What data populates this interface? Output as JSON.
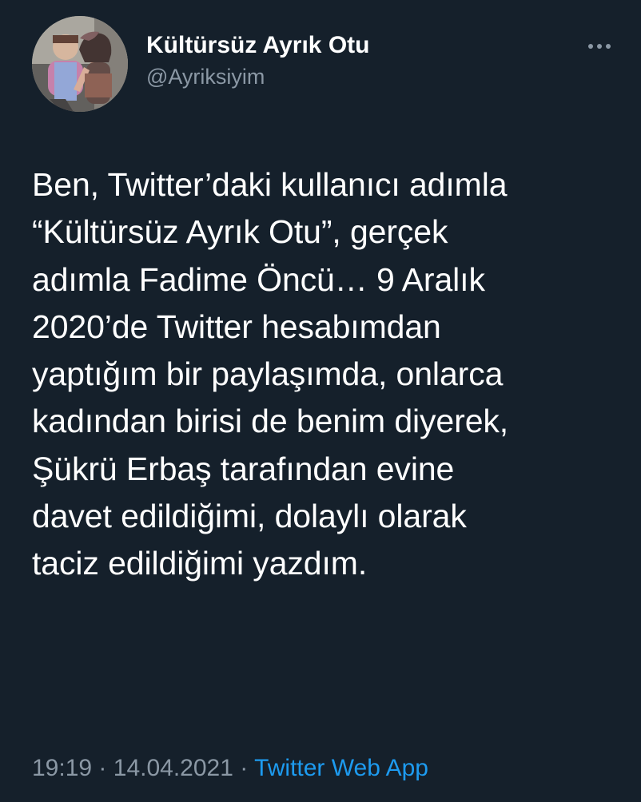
{
  "tweet": {
    "author": {
      "display_name": "Kültürsüz Ayrık Otu",
      "handle": "@Ayriksiyim",
      "avatar_icon": "profile-photo"
    },
    "more_icon": "more-horizontal-icon",
    "body_lines": [
      "Ben, Twitter’daki kullanıcı adımla",
      "“Kültürsüz Ayrık Otu”, gerçek",
      "adımla Fadime Öncü… 9 Aralık",
      "2020’de Twitter hesabımdan",
      "yaptığım bir paylaşımda, onlarca",
      "kadından birisi de benim diyerek,",
      "Şükrü Erbaş tarafından evine",
      "davet edildiğimi, dolaylı olarak",
      "taciz edildiğimi yazdım."
    ],
    "time": "19:19",
    "date": "14.04.2021",
    "separator": "·",
    "source": "Twitter Web App"
  },
  "colors": {
    "background": "#15202b",
    "text": "#ffffff",
    "muted": "#8b98a5",
    "accent": "#1d9bf0"
  }
}
